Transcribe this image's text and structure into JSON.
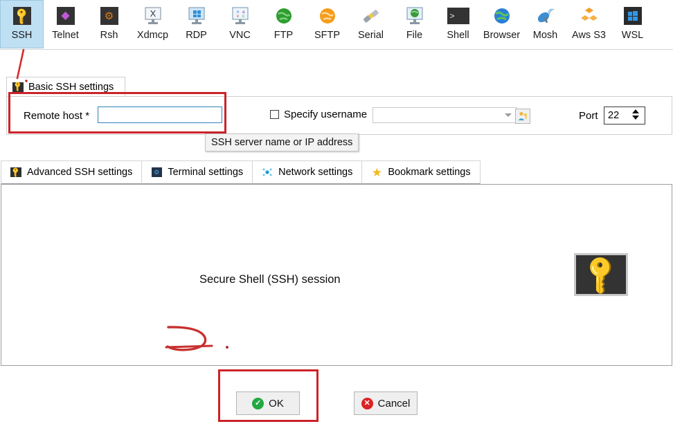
{
  "toolbar": {
    "items": [
      {
        "label": "SSH",
        "icon": "key-icon",
        "selected": true
      },
      {
        "label": "Telnet",
        "icon": "telnet-icon",
        "selected": false
      },
      {
        "label": "Rsh",
        "icon": "gears-icon",
        "selected": false
      },
      {
        "label": "Xdmcp",
        "icon": "xdmcp-icon",
        "selected": false
      },
      {
        "label": "RDP",
        "icon": "rdp-monitor-icon",
        "selected": false
      },
      {
        "label": "VNC",
        "icon": "vnc-monitor-icon",
        "selected": false
      },
      {
        "label": "FTP",
        "icon": "globe-green-icon",
        "selected": false
      },
      {
        "label": "SFTP",
        "icon": "globe-orange-icon",
        "selected": false
      },
      {
        "label": "Serial",
        "icon": "serial-plug-icon",
        "selected": false
      },
      {
        "label": "File",
        "icon": "file-globe-icon",
        "selected": false
      },
      {
        "label": "Shell",
        "icon": "shell-prompt-icon",
        "selected": false
      },
      {
        "label": "Browser",
        "icon": "browser-globe-icon",
        "selected": false
      },
      {
        "label": "Mosh",
        "icon": "satellite-icon",
        "selected": false
      },
      {
        "label": "Aws S3",
        "icon": "aws-s3-icon",
        "selected": false
      },
      {
        "label": "WSL",
        "icon": "windows-icon",
        "selected": false
      }
    ]
  },
  "basic_tab": {
    "label": "Basic SSH settings",
    "icon": "key-icon"
  },
  "basic_settings": {
    "remote_host_label": "Remote host *",
    "remote_host_value": "",
    "remote_host_placeholder": "",
    "specify_username_label": "Specify username",
    "specify_username_checked": false,
    "username_value": "",
    "user_key_button_icon": "user-key-icon",
    "port_label": "Port",
    "port_value": "22"
  },
  "tooltip": {
    "text": "SSH server name or IP address"
  },
  "sub_tabs": [
    {
      "label": "Advanced SSH settings",
      "icon": "key-icon"
    },
    {
      "label": "Terminal settings",
      "icon": "terminal-icon"
    },
    {
      "label": "Network settings",
      "icon": "network-dots-icon"
    },
    {
      "label": "Bookmark settings",
      "icon": "star-icon"
    }
  ],
  "content": {
    "session_title": "Secure Shell (SSH) session",
    "session_icon": "key-icon"
  },
  "buttons": {
    "ok_label": "OK",
    "ok_badge": "✓",
    "cancel_label": "Cancel",
    "cancel_badge": "✕"
  },
  "annotations": {
    "accent_color": "#cc2229",
    "marks": [
      "remote-host-highlight",
      "ok-button-highlight",
      "ssh-tab-pointer-line",
      "freehand-squiggle"
    ]
  }
}
